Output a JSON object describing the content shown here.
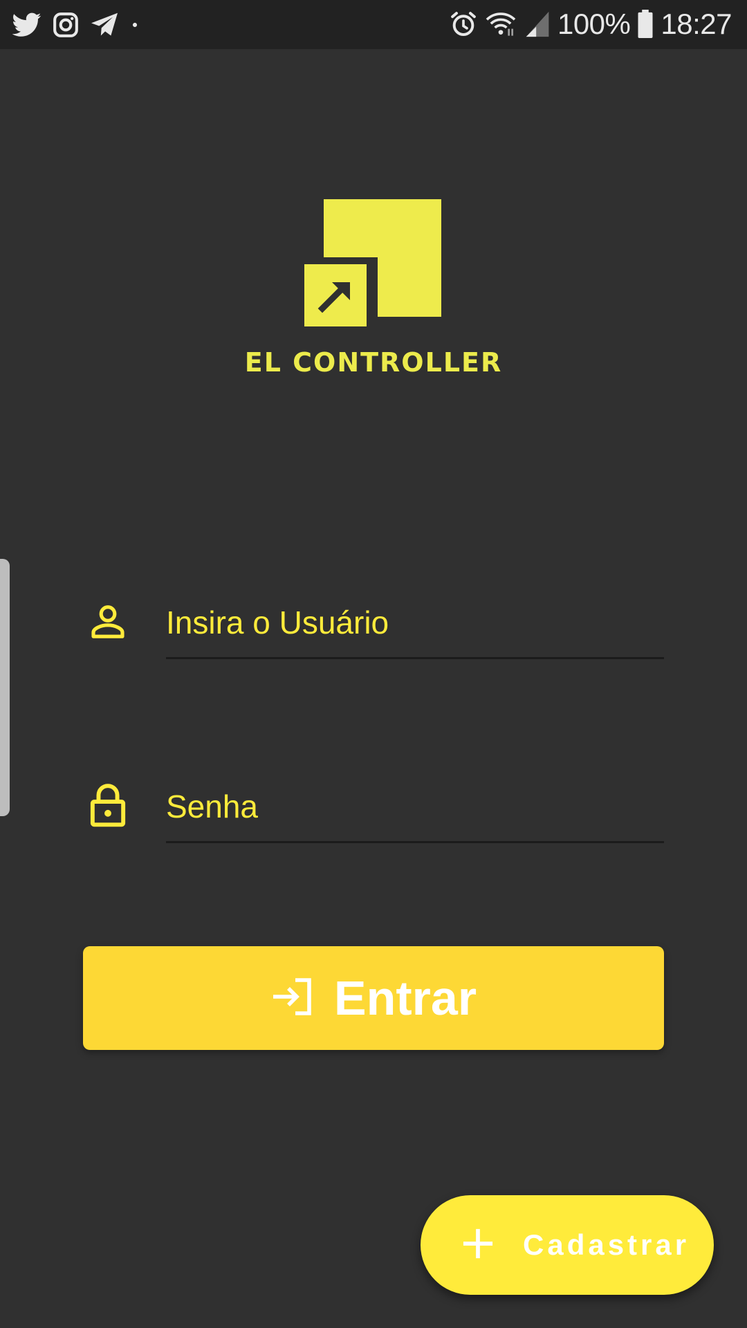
{
  "status_bar": {
    "left_icons": [
      "twitter-icon",
      "instagram-icon",
      "telegram-icon",
      "dot-icon"
    ],
    "right_icons": [
      "alarm-icon",
      "wifi-icon",
      "signal-icon",
      "battery-icon"
    ],
    "battery": "100%",
    "time": "18:27"
  },
  "logo": {
    "text": "EL CONTROLLER",
    "accent_color": "#EEEB4C"
  },
  "login": {
    "username_placeholder": "Insira o Usuário",
    "username_icon": "person-icon",
    "password_placeholder": "Senha",
    "password_icon": "lock-icon",
    "submit_label": "Entrar",
    "submit_icon": "login-icon"
  },
  "fab": {
    "label": "Cadastrar",
    "icon": "plus-icon"
  },
  "colors": {
    "background": "#303030",
    "status_bar": "#222222",
    "accent": "#FFEB3B",
    "button": "#FDD835"
  }
}
